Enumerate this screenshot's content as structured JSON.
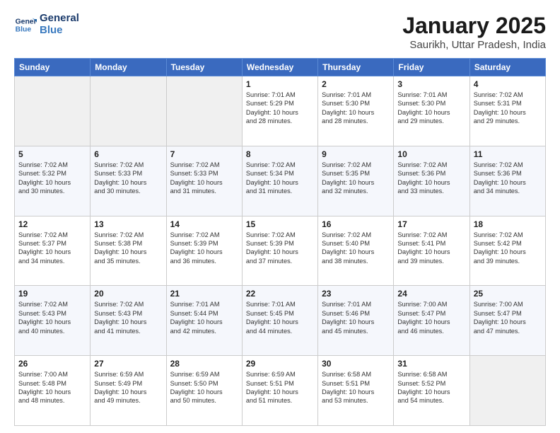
{
  "header": {
    "logo_line1": "General",
    "logo_line2": "Blue",
    "title": "January 2025",
    "subtitle": "Saurikh, Uttar Pradesh, India"
  },
  "weekdays": [
    "Sunday",
    "Monday",
    "Tuesday",
    "Wednesday",
    "Thursday",
    "Friday",
    "Saturday"
  ],
  "weeks": [
    [
      {
        "day": "",
        "info": ""
      },
      {
        "day": "",
        "info": ""
      },
      {
        "day": "",
        "info": ""
      },
      {
        "day": "1",
        "info": "Sunrise: 7:01 AM\nSunset: 5:29 PM\nDaylight: 10 hours\nand 28 minutes."
      },
      {
        "day": "2",
        "info": "Sunrise: 7:01 AM\nSunset: 5:30 PM\nDaylight: 10 hours\nand 28 minutes."
      },
      {
        "day": "3",
        "info": "Sunrise: 7:01 AM\nSunset: 5:30 PM\nDaylight: 10 hours\nand 29 minutes."
      },
      {
        "day": "4",
        "info": "Sunrise: 7:02 AM\nSunset: 5:31 PM\nDaylight: 10 hours\nand 29 minutes."
      }
    ],
    [
      {
        "day": "5",
        "info": "Sunrise: 7:02 AM\nSunset: 5:32 PM\nDaylight: 10 hours\nand 30 minutes."
      },
      {
        "day": "6",
        "info": "Sunrise: 7:02 AM\nSunset: 5:33 PM\nDaylight: 10 hours\nand 30 minutes."
      },
      {
        "day": "7",
        "info": "Sunrise: 7:02 AM\nSunset: 5:33 PM\nDaylight: 10 hours\nand 31 minutes."
      },
      {
        "day": "8",
        "info": "Sunrise: 7:02 AM\nSunset: 5:34 PM\nDaylight: 10 hours\nand 31 minutes."
      },
      {
        "day": "9",
        "info": "Sunrise: 7:02 AM\nSunset: 5:35 PM\nDaylight: 10 hours\nand 32 minutes."
      },
      {
        "day": "10",
        "info": "Sunrise: 7:02 AM\nSunset: 5:36 PM\nDaylight: 10 hours\nand 33 minutes."
      },
      {
        "day": "11",
        "info": "Sunrise: 7:02 AM\nSunset: 5:36 PM\nDaylight: 10 hours\nand 34 minutes."
      }
    ],
    [
      {
        "day": "12",
        "info": "Sunrise: 7:02 AM\nSunset: 5:37 PM\nDaylight: 10 hours\nand 34 minutes."
      },
      {
        "day": "13",
        "info": "Sunrise: 7:02 AM\nSunset: 5:38 PM\nDaylight: 10 hours\nand 35 minutes."
      },
      {
        "day": "14",
        "info": "Sunrise: 7:02 AM\nSunset: 5:39 PM\nDaylight: 10 hours\nand 36 minutes."
      },
      {
        "day": "15",
        "info": "Sunrise: 7:02 AM\nSunset: 5:39 PM\nDaylight: 10 hours\nand 37 minutes."
      },
      {
        "day": "16",
        "info": "Sunrise: 7:02 AM\nSunset: 5:40 PM\nDaylight: 10 hours\nand 38 minutes."
      },
      {
        "day": "17",
        "info": "Sunrise: 7:02 AM\nSunset: 5:41 PM\nDaylight: 10 hours\nand 39 minutes."
      },
      {
        "day": "18",
        "info": "Sunrise: 7:02 AM\nSunset: 5:42 PM\nDaylight: 10 hours\nand 39 minutes."
      }
    ],
    [
      {
        "day": "19",
        "info": "Sunrise: 7:02 AM\nSunset: 5:43 PM\nDaylight: 10 hours\nand 40 minutes."
      },
      {
        "day": "20",
        "info": "Sunrise: 7:02 AM\nSunset: 5:43 PM\nDaylight: 10 hours\nand 41 minutes."
      },
      {
        "day": "21",
        "info": "Sunrise: 7:01 AM\nSunset: 5:44 PM\nDaylight: 10 hours\nand 42 minutes."
      },
      {
        "day": "22",
        "info": "Sunrise: 7:01 AM\nSunset: 5:45 PM\nDaylight: 10 hours\nand 44 minutes."
      },
      {
        "day": "23",
        "info": "Sunrise: 7:01 AM\nSunset: 5:46 PM\nDaylight: 10 hours\nand 45 minutes."
      },
      {
        "day": "24",
        "info": "Sunrise: 7:00 AM\nSunset: 5:47 PM\nDaylight: 10 hours\nand 46 minutes."
      },
      {
        "day": "25",
        "info": "Sunrise: 7:00 AM\nSunset: 5:47 PM\nDaylight: 10 hours\nand 47 minutes."
      }
    ],
    [
      {
        "day": "26",
        "info": "Sunrise: 7:00 AM\nSunset: 5:48 PM\nDaylight: 10 hours\nand 48 minutes."
      },
      {
        "day": "27",
        "info": "Sunrise: 6:59 AM\nSunset: 5:49 PM\nDaylight: 10 hours\nand 49 minutes."
      },
      {
        "day": "28",
        "info": "Sunrise: 6:59 AM\nSunset: 5:50 PM\nDaylight: 10 hours\nand 50 minutes."
      },
      {
        "day": "29",
        "info": "Sunrise: 6:59 AM\nSunset: 5:51 PM\nDaylight: 10 hours\nand 51 minutes."
      },
      {
        "day": "30",
        "info": "Sunrise: 6:58 AM\nSunset: 5:51 PM\nDaylight: 10 hours\nand 53 minutes."
      },
      {
        "day": "31",
        "info": "Sunrise: 6:58 AM\nSunset: 5:52 PM\nDaylight: 10 hours\nand 54 minutes."
      },
      {
        "day": "",
        "info": ""
      }
    ]
  ]
}
